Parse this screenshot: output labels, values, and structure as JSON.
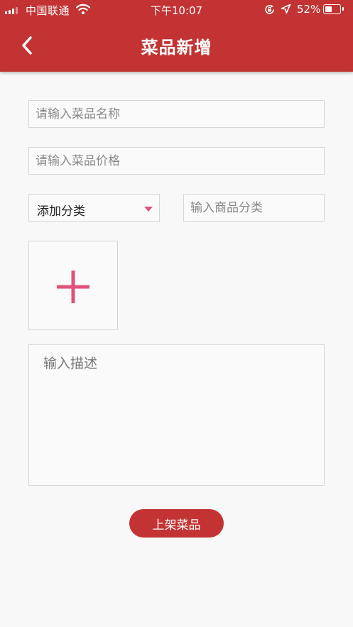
{
  "status_bar": {
    "carrier": "中国联通",
    "time": "下午10:07",
    "battery_percent": "52%",
    "battery_level": 0.52,
    "icons": [
      "signal-icon",
      "wifi-icon",
      "orientation-lock-icon",
      "location-icon",
      "battery-icon"
    ]
  },
  "header": {
    "title": "菜品新增",
    "back_icon": "chevron-left-icon"
  },
  "form": {
    "name_placeholder": "请输入菜品名称",
    "price_placeholder": "请输入菜品价格",
    "category_select_label": "添加分类",
    "category_caret_icon": "caret-down-icon",
    "category_input_placeholder": "输入商品分类",
    "image_upload_icon": "plus-icon",
    "description_placeholder": "输入描述",
    "submit_label": "上架菜品"
  },
  "colors": {
    "primary": "#c33333",
    "accent": "#e0527a",
    "background": "#f8f8f8",
    "border": "#d6d6d6"
  }
}
